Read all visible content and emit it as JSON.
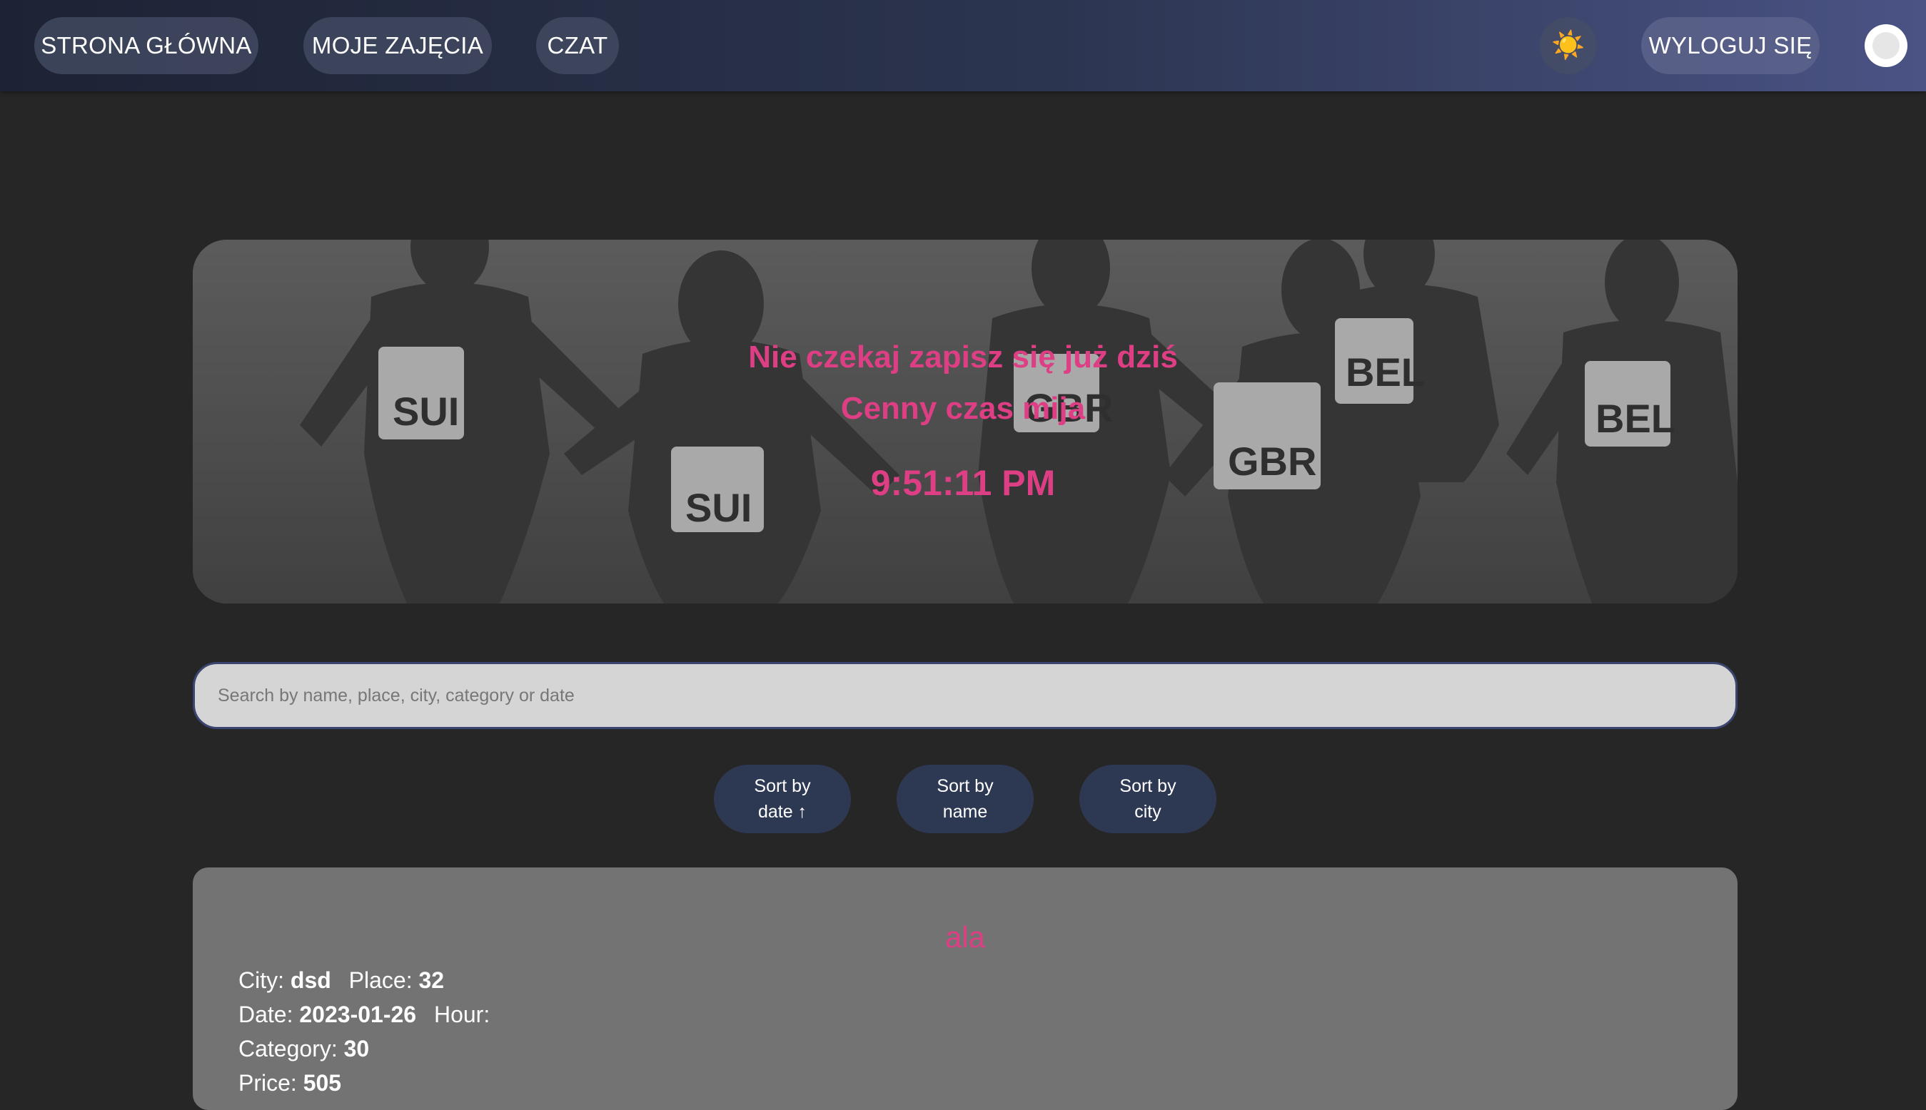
{
  "nav": {
    "home": "STRONA GŁÓWNA",
    "classes": "MOJE ZAJĘCIA",
    "chat": "CZAT",
    "theme_icon": "☀️",
    "logout": "WYLOGUJ SIĘ"
  },
  "hero": {
    "line1": "Nie czekaj zapisz się już dziś",
    "line2": "Cenny czas mija",
    "clock": "9:51:11 PM"
  },
  "search": {
    "placeholder": "Search by name, place, city, category or date"
  },
  "sort": {
    "date_line1": "Sort by",
    "date_line2": "date ↑",
    "name_line1": "Sort by",
    "name_line2": "name",
    "city_line1": "Sort by",
    "city_line2": "city"
  },
  "event": {
    "title": "ala",
    "city_label": "City:",
    "city": "dsd",
    "place_label": "Place:",
    "place": "32",
    "date_label": "Date:",
    "date": "2023-01-26",
    "hour_label": "Hour:",
    "hour": "",
    "category_label": "Category:",
    "category": "30",
    "price_label": "Price:",
    "price": "505"
  },
  "colors": {
    "accent": "#de3f84",
    "nav_start": "#1d2334",
    "nav_end": "#4a5384",
    "sort_button": "#2d3852",
    "card": "#737373",
    "background": "#262626"
  }
}
